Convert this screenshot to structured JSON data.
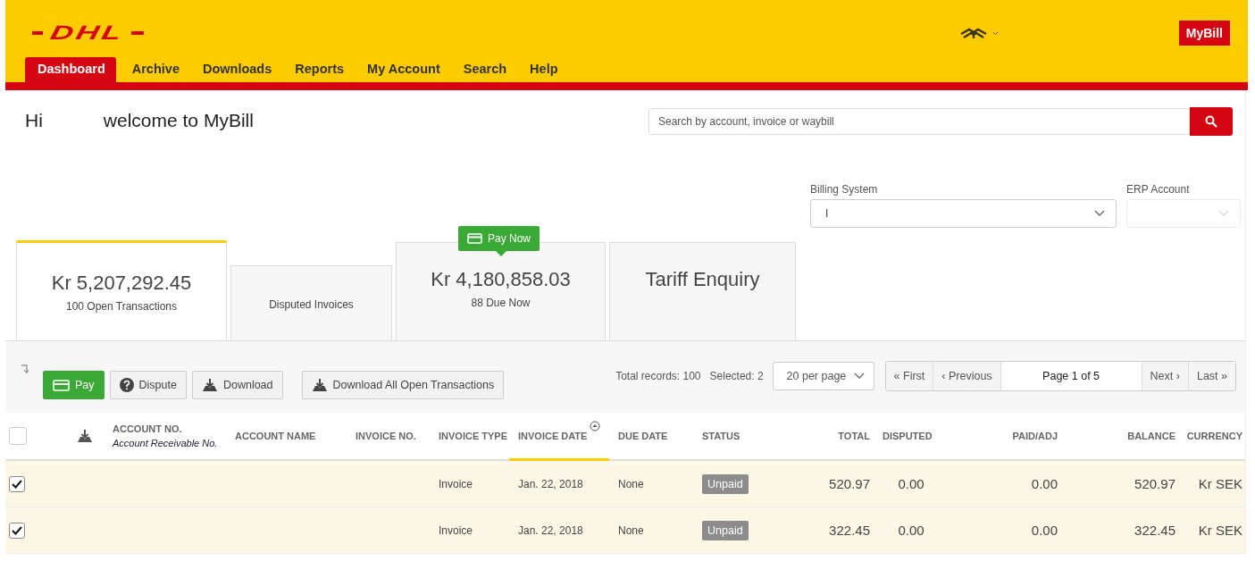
{
  "header": {
    "logo": "DHL",
    "nav": [
      {
        "label": "Dashboard",
        "selected": true
      },
      {
        "label": "Archive",
        "selected": false
      },
      {
        "label": "Downloads",
        "selected": false
      },
      {
        "label": "Reports",
        "selected": false
      },
      {
        "label": "My Account",
        "selected": false
      },
      {
        "label": "Search",
        "selected": false
      },
      {
        "label": "Help",
        "selected": false
      }
    ],
    "app_button": "MyBill"
  },
  "greeting": {
    "hi": "Hi",
    "welcome": "welcome to MyBill"
  },
  "search": {
    "placeholder": "Search by account, invoice or waybill"
  },
  "filters": [
    {
      "label": "Billing System",
      "value": "I",
      "disabled": false
    },
    {
      "label": "ERP Account",
      "disabled": true
    }
  ],
  "cards": [
    {
      "kind": "amount",
      "amount": "Kr 5,207,292.45",
      "caption": "100 Open Transactions",
      "selected": true
    },
    {
      "kind": "label",
      "caption": "Disputed Invoices",
      "selected": false
    },
    {
      "kind": "amount",
      "amount": "Kr 4,180,858.03",
      "caption": "88 Due Now",
      "badge": "Pay Now",
      "selected": false
    },
    {
      "kind": "title",
      "amount": "Tariff Enquiry",
      "selected": false
    }
  ],
  "toolbar": {
    "buttons": [
      {
        "label": "Pay",
        "kind": "pay"
      },
      {
        "label": "Dispute",
        "kind": "dispute"
      },
      {
        "label": "Download",
        "kind": "download"
      },
      {
        "label": "Download All Open Transactions",
        "kind": "download-all"
      }
    ],
    "total_records": "Total records: 100",
    "selected_count": "Selected: 2",
    "per_page": "20 per page",
    "pager": {
      "first": "« First",
      "previous": "‹ Previous",
      "page": "Page 1 of 5",
      "next": "Next ›",
      "last": "Last »"
    }
  },
  "table": {
    "all_checked": false,
    "columns": [
      {
        "label": "ACCOUNT NO.",
        "sublabel": "Account Receivable No.",
        "sorted": false
      },
      {
        "label": "ACCOUNT NAME",
        "sorted": false
      },
      {
        "label": "INVOICE NO.",
        "sorted": false
      },
      {
        "label": "INVOICE TYPE",
        "sorted": false
      },
      {
        "label": "INVOICE DATE",
        "sorted": true
      },
      {
        "label": "DUE DATE",
        "sorted": false
      },
      {
        "label": "STATUS",
        "sorted": false
      },
      {
        "label": "TOTAL",
        "sorted": false
      },
      {
        "label": "DISPUTED",
        "sorted": false
      },
      {
        "label": "PAID/ADJ",
        "sorted": false
      },
      {
        "label": "BALANCE",
        "sorted": false
      },
      {
        "label": "CURRENCY",
        "sorted": false
      }
    ],
    "rows": [
      {
        "checked": true,
        "invoice_type": "Invoice",
        "invoice_date": "Jan. 22, 2018",
        "due_date": "None",
        "status": "Unpaid",
        "total": "520.97",
        "disputed": "0.00",
        "paid_adj": "0.00",
        "balance": "520.97",
        "currency": "Kr SEK"
      },
      {
        "checked": true,
        "invoice_type": "Invoice",
        "invoice_date": "Jan. 22, 2018",
        "due_date": "None",
        "status": "Unpaid",
        "total": "322.45",
        "disputed": "0.00",
        "paid_adj": "0.00",
        "balance": "322.45",
        "currency": "Kr SEK"
      }
    ]
  }
}
